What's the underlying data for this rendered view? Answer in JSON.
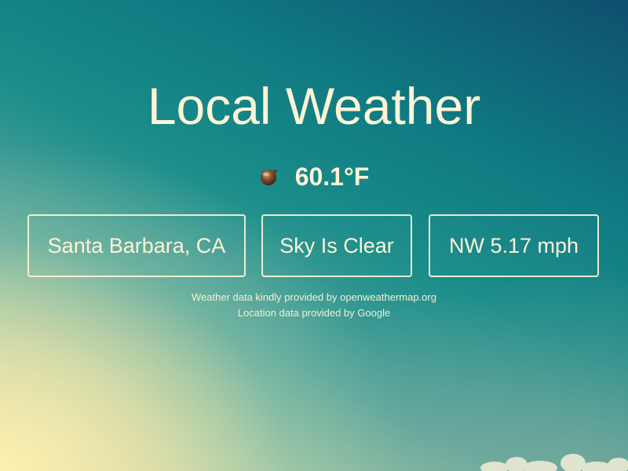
{
  "header": {
    "title": "Local Weather"
  },
  "current": {
    "icon": "clear-sky-icon",
    "temperature": "60.1°F"
  },
  "boxes": {
    "location": "Santa Barbara, CA",
    "condition": "Sky Is Clear",
    "wind": "NW 5.17 mph"
  },
  "credits": {
    "weather": "Weather data kindly provided by openweathermap.org",
    "location": "Location data provided by Google"
  },
  "colors": {
    "text": "#fdf5d6",
    "sky_top": "#0f4f6e",
    "sky_mid": "#1a8d8a",
    "sky_bottom": "#e7e3ad"
  }
}
